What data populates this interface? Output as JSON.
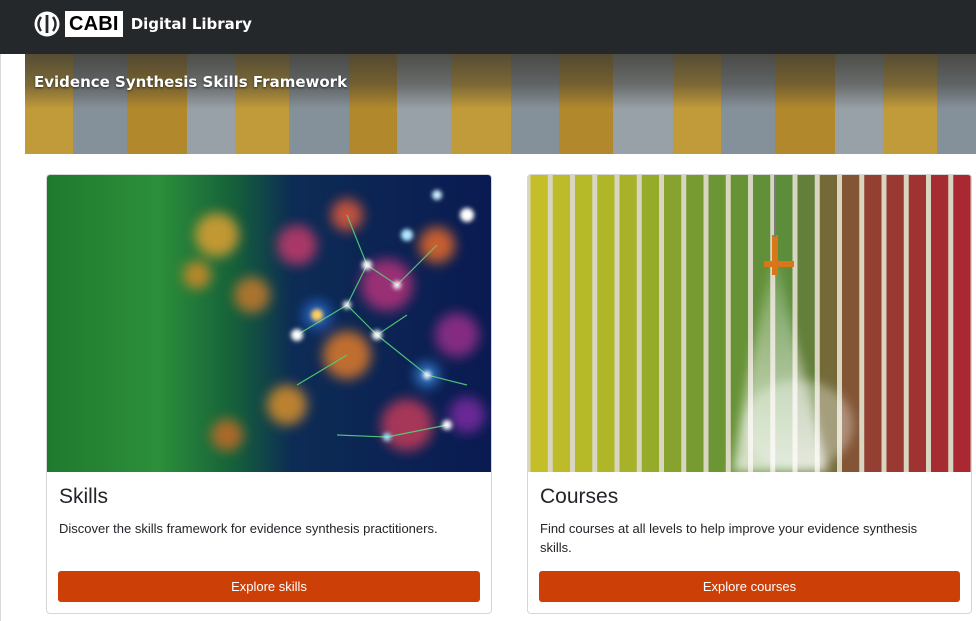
{
  "header": {
    "logo_text": "CABI",
    "site_name": "Digital Library"
  },
  "banner": {
    "title": "Evidence Synthesis Skills Framework"
  },
  "cards": [
    {
      "title": "Skills",
      "description": "Discover the skills framework for evidence synthesis practitioners.",
      "button_label": "Explore skills",
      "image": "network-abstract-image"
    },
    {
      "title": "Courses",
      "description": "Find courses at all levels to help improve your evidence synthesis skills.",
      "button_label": "Explore courses",
      "image": "crop-field-irrigation-image"
    }
  ],
  "colors": {
    "topbar": "#25282b",
    "button": "#cc4008",
    "button_text": "#ffffff"
  }
}
